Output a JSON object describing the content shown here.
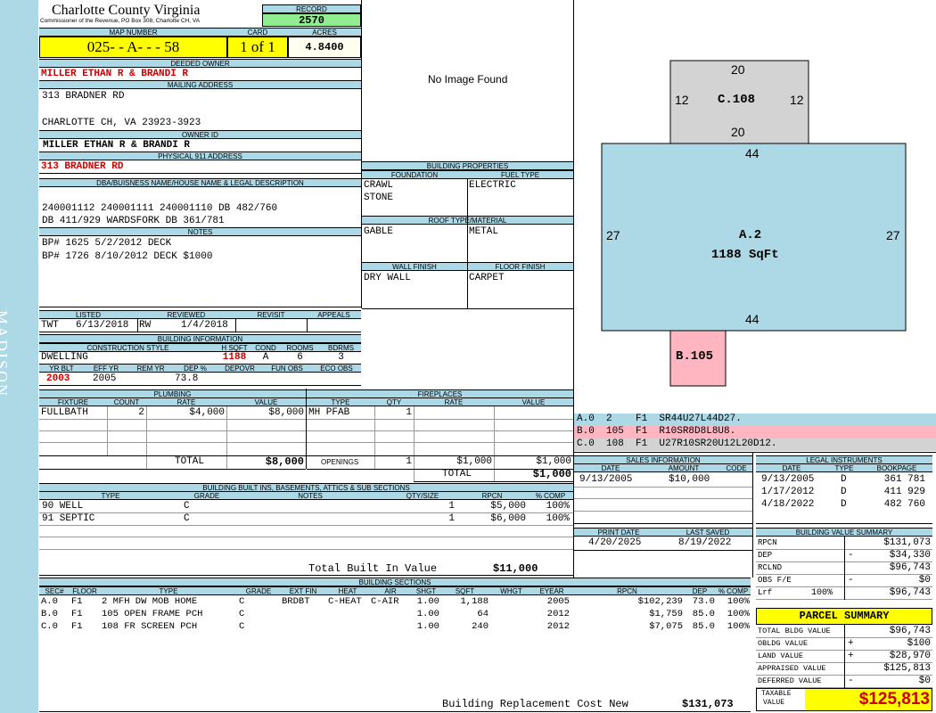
{
  "sidebar": {
    "district": "MADISON"
  },
  "header": {
    "county": "Charlotte County Virginia",
    "commissioner": "Commissioner of the Revenue, PO Box 308, Charlotte CH, VA",
    "record_label": "RECORD",
    "record": "2570",
    "map_label": "MAP NUMBER",
    "map_number": "025- - A- - - 58",
    "card_label": "CARD",
    "card": "1 of 1",
    "acres_label": "ACRES",
    "acres": "4.8400"
  },
  "owner": {
    "deeded_label": "DEEDED OWNER",
    "deeded": "MILLER ETHAN R & BRANDI R",
    "mailing_label": "MAILING ADDRESS",
    "mailing_line1": "313 BRADNER RD",
    "mailing_line2": "CHARLOTTE CH, VA 23923-3923",
    "owner_id_label": "OWNER ID",
    "owner_id": "MILLER ETHAN R & BRANDI R",
    "physical_label": "PHYSICAL 911 ADDRESS",
    "physical": "313 BRADNER RD"
  },
  "legal": {
    "label": "DBA/BUISNESS NAME/HOUSE NAME & LEGAL DESCRIPTION",
    "line1": "240001112 240001111 240001110 DB 482/760",
    "line2": "DB 411/929 WARDSFORK DB 361/781"
  },
  "notes": {
    "label": "NOTES",
    "line1": "BP# 1625 5/2/2012 DECK",
    "line2": "BP# 1726 8/10/2012 DECK $1000"
  },
  "review": {
    "listed_label": "LISTED",
    "reviewed_label": "REVIEWED",
    "revisit_label": "REVISIT",
    "appeals_label": "APPEALS",
    "listed_by": "TWT",
    "listed": "6/13/2018",
    "reviewed_by": "RW",
    "reviewed": "1/4/2018"
  },
  "building_info": {
    "label": "BUILDING INFORMATION",
    "style_label": "CONSTRUCTION STYLE",
    "hsqft_label": "H SQFT",
    "cond_label": "COND",
    "rooms_label": "ROOMS",
    "bdrms_label": "BDRMS",
    "style": "DWELLING",
    "hsqft": "1188",
    "cond": "A",
    "rooms": "6",
    "bdrms": "3",
    "yrblt_label": "YR BLT",
    "effyr_label": "EFF YR",
    "remyr_label": "REM YR",
    "dep_label": "DEP %",
    "depovr_label": "DEPOVR",
    "funobs_label": "FUN OBS",
    "ecoobs_label": "ECO OBS",
    "yrblt": "2003",
    "effyr": "2005",
    "dep": "73.8"
  },
  "plumbing": {
    "label": "PLUMBING",
    "cols": [
      "FIXTURE",
      "COUNT",
      "RATE",
      "VALUE"
    ],
    "row": {
      "fixture": "FULLBATH",
      "count": "2",
      "rate": "$4,000",
      "value": "$8,000"
    },
    "total_label": "TOTAL",
    "total": "$8,000"
  },
  "fireplaces": {
    "label": "FIREPLACES",
    "cols": [
      "TYPE",
      "QTY",
      "RATE",
      "VALUE"
    ],
    "row": {
      "type": "MH PFAB",
      "qty": "1"
    },
    "openings_label": "OPENINGS",
    "openings_qty": "1",
    "openings_rate": "$1,000",
    "openings_value": "$1,000",
    "total_label": "TOTAL",
    "total": "$1,000"
  },
  "builtins": {
    "label": "BUILDING BUILT INS, BASEMENTS, ATTICS & SUB SECTIONS",
    "cols": [
      "TYPE",
      "GRADE",
      "NOTES",
      "QTY/SIZE",
      "RPCN",
      "% COMP"
    ],
    "rows": [
      {
        "type": "90 WELL",
        "grade": "C",
        "qty": "1",
        "rpcn": "$5,000",
        "comp": "100%"
      },
      {
        "type": "91 SEPTIC",
        "grade": "C",
        "qty": "1",
        "rpcn": "$6,000",
        "comp": "100%"
      }
    ],
    "total_label": "Total Built In Value",
    "total": "$11,000"
  },
  "sections": {
    "label": "BUILDING SECTIONS",
    "cols": [
      "SEC#",
      "FLOOR",
      "TYPE",
      "GRADE",
      "EXT FIN",
      "HEAT",
      "AIR",
      "SHGT",
      "SQFT",
      "WHGT",
      "EYEAR",
      "RPCN",
      "DEP",
      "% COMP"
    ],
    "rows": [
      {
        "sec": "A.0",
        "floor": "F1",
        "type": "2 MFH DW MOB HOME",
        "grade": "C",
        "extfin": "BRDBT",
        "heat": "C-HEAT",
        "air": "C-AIR",
        "shgt": "1.00",
        "sqft": "1,188",
        "eyear": "2005",
        "rpcn": "$102,239",
        "dep": "73.0",
        "comp": "100%"
      },
      {
        "sec": "B.0",
        "floor": "F1",
        "type": "105 OPEN FRAME PCH",
        "grade": "C",
        "extfin": "",
        "heat": "",
        "air": "",
        "shgt": "1.00",
        "sqft": "64",
        "eyear": "2012",
        "rpcn": "$1,759",
        "dep": "85.0",
        "comp": "100%"
      },
      {
        "sec": "C.0",
        "floor": "F1",
        "type": "108 FR SCREEN PCH",
        "grade": "C",
        "extfin": "",
        "heat": "",
        "air": "",
        "shgt": "1.00",
        "sqft": "240",
        "eyear": "2012",
        "rpcn": "$7,075",
        "dep": "85.0",
        "comp": "100%"
      }
    ],
    "brcn_label": "Building Replacement Cost New",
    "brcn": "$131,073"
  },
  "photo": {
    "text": "No Image Found"
  },
  "properties": {
    "label": "BUILDING PROPERTIES",
    "foundation_label": "FOUNDATION",
    "fuel_label": "FUEL TYPE",
    "foundation1": "CRAWL",
    "foundation2": "STONE",
    "fuel": "ELECTRIC",
    "roof_label": "ROOF TYPE/MATERIAL",
    "roof_type": "GABLE",
    "roof_mat": "METAL",
    "wall_label": "WALL FINISH",
    "floor_label": "FLOOR FINISH",
    "wall": "DRY WALL",
    "floor": "CARPET"
  },
  "sketch": {
    "c_top": "20",
    "c_left": "12",
    "c_right": "12",
    "c_bottom": "20",
    "c_label": "C.108",
    "a_top": "44",
    "a_left": "27",
    "a_right": "27",
    "a_bottom": "44",
    "a_label": "A.2",
    "a_area": "1188 SqFt",
    "b_label": "B.105"
  },
  "vectors": [
    {
      "text": "A.0  2    F1  SR44U27L44D27.",
      "color": "#add8e6"
    },
    {
      "text": "B.0  105  F1  R10SR8D8L8U8.",
      "color": "#ffb6c1"
    },
    {
      "text": "C.0  108  F1  U27R10SR20U12L20D12.",
      "color": "#d3d3d3"
    }
  ],
  "sales": {
    "label": "SALES INFORMATION",
    "cols": [
      "DATE",
      "AMOUNT",
      "CODE"
    ],
    "date": "9/13/2005",
    "amount": "$10,000"
  },
  "instruments": {
    "label": "LEGAL INSTRUMENTS",
    "cols": [
      "DATE",
      "TYPE",
      "BOOKPAGE"
    ],
    "rows": [
      {
        "date": "9/13/2005",
        "type": "D",
        "book": "361 781"
      },
      {
        "date": "1/17/2012",
        "type": "D",
        "book": "411 929"
      },
      {
        "date": "4/18/2022",
        "type": "D",
        "book": "482 760"
      }
    ]
  },
  "print": {
    "print_label": "PRINT DATE",
    "saved_label": "LAST SAVED",
    "print_date": "4/20/2025",
    "saved": "8/19/2022"
  },
  "value_summary": {
    "label": "BUILDING VALUE SUMMARY",
    "rows": [
      {
        "k": "RPCN",
        "s": "",
        "v": "$131,073"
      },
      {
        "k": "DEP",
        "s": "-",
        "v": "$34,330"
      },
      {
        "k": "RCLND",
        "s": "",
        "v": "$96,743"
      },
      {
        "k": "OBS F/E",
        "s": "-",
        "v": "$0"
      },
      {
        "k": "Lrf",
        "p": "100%",
        "s": "",
        "v": "$96,743"
      }
    ]
  },
  "parcel": {
    "label": "PARCEL SUMMARY",
    "rows": [
      {
        "k": "TOTAL BLDG VALUE",
        "s": "",
        "v": "$96,743"
      },
      {
        "k": "OBLDG VALUE",
        "s": "+",
        "v": "$100"
      },
      {
        "k": "LAND VALUE",
        "s": "+",
        "v": "$28,970"
      },
      {
        "k": "APPRAISED VALUE",
        "s": "",
        "v": "$125,813"
      },
      {
        "k": "DEFERRED VALUE",
        "s": "-",
        "v": "$0"
      }
    ],
    "taxable_label1": "TAXABLE",
    "taxable_label2": "VALUE",
    "taxable": "$125,813"
  }
}
